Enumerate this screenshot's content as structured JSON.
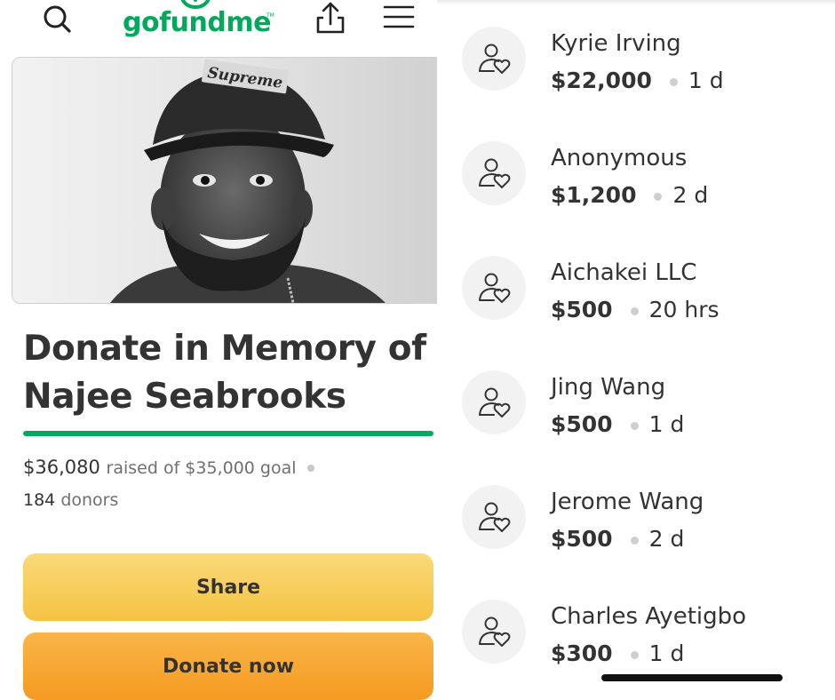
{
  "header": {
    "logo_text": "gofundme",
    "logo_tm": "TM"
  },
  "campaign": {
    "title": "Donate in Memory of Najee Seabrooks",
    "raised_amount": "$36,080",
    "raised_rest": "raised of $35,000 goal",
    "donor_count": "184",
    "donor_label": "donors",
    "progress_fraction": 1.0,
    "hat_brand": "Supreme"
  },
  "actions": {
    "share_label": "Share",
    "donate_label": "Donate now"
  },
  "donations": [
    {
      "name": "Kyrie Irving",
      "amount": "$22,000",
      "time": "1 d"
    },
    {
      "name": "Anonymous",
      "amount": "$1,200",
      "time": "2 d"
    },
    {
      "name": "Aichakei LLC",
      "amount": "$500",
      "time": "20 hrs"
    },
    {
      "name": "Jing Wang",
      "amount": "$500",
      "time": "1 d"
    },
    {
      "name": "Jerome Wang",
      "amount": "$500",
      "time": "2 d"
    },
    {
      "name": "Charles Ayetigbo",
      "amount": "$300",
      "time": "1 d"
    }
  ],
  "colors": {
    "brand_green": "#02a95c",
    "share_yellow": "#f6c343",
    "donate_orange": "#f59a22",
    "text_dark": "#333333"
  },
  "icons": [
    "search-icon",
    "share-upload-icon",
    "hamburger-menu-icon",
    "donor-heart-avatar-icon"
  ]
}
